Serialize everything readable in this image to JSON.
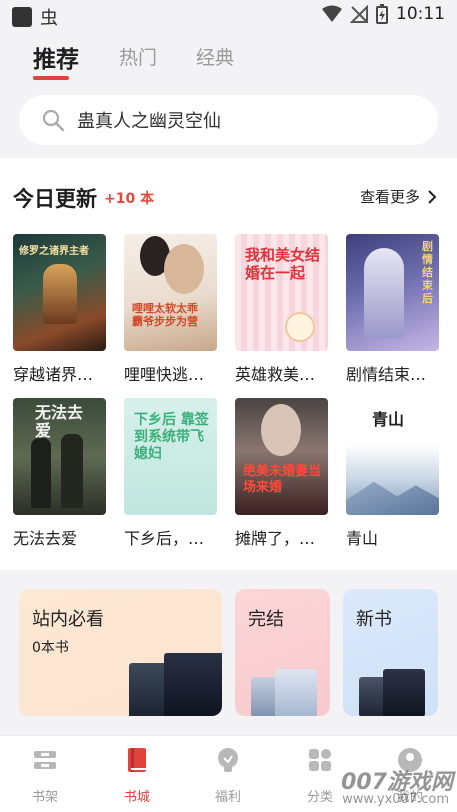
{
  "status": {
    "time": "10:11",
    "app_glyph": "虫"
  },
  "tabs": [
    {
      "label": "推荐"
    },
    {
      "label": "热门"
    },
    {
      "label": "经典"
    }
  ],
  "search": {
    "text": "蛊真人之幽灵空仙"
  },
  "today": {
    "title": "今日更新",
    "count": "+10 本",
    "more": "查看更多",
    "books": [
      {
        "title": "穿越诸界…",
        "cover_text": "修罗之诸界主者"
      },
      {
        "title": "哩哩快逃…",
        "cover_text": "哩哩太软太乖 霸爷步步为营"
      },
      {
        "title": "英雄救美…",
        "cover_text": "我和美女结婚在一起"
      },
      {
        "title": "剧情结束…",
        "cover_text": "剧情结束后"
      },
      {
        "title": "无法去爱",
        "cover_text": "无法去爱"
      },
      {
        "title": "下乡后，…",
        "cover_text": "下乡后 靠签到系统带飞媳妇"
      },
      {
        "title": "摊牌了，…",
        "cover_text": "绝美未婚妻当场来婚"
      },
      {
        "title": "青山",
        "cover_text": "青山"
      }
    ]
  },
  "categories": [
    {
      "label": "站内必看",
      "sub": "0本书"
    },
    {
      "label": "完结"
    },
    {
      "label": "新书"
    }
  ],
  "nav": [
    {
      "label": "书架"
    },
    {
      "label": "书城"
    },
    {
      "label": "福利"
    },
    {
      "label": "分类"
    },
    {
      "label": "我的"
    }
  ],
  "watermark": {
    "main": "007游戏网",
    "url": "www.yx007.com"
  },
  "colors": {
    "accent": "#e0433e",
    "count_red": "#e14a3f"
  }
}
